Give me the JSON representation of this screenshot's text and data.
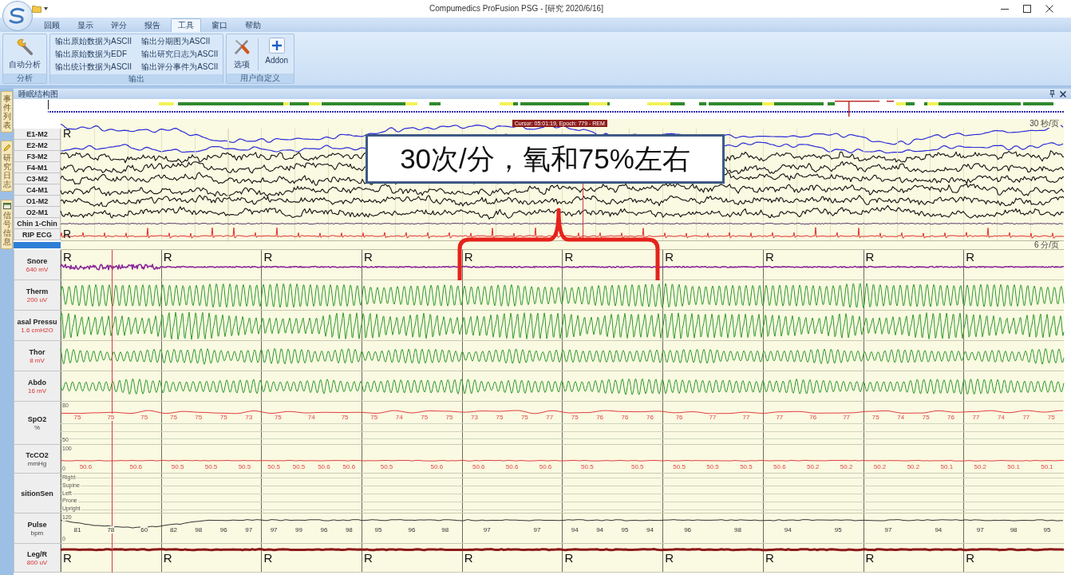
{
  "window": {
    "title": "Compumedics ProFusion PSG - [研究 2020/6/16]"
  },
  "ribbon": {
    "tabs": [
      {
        "label": "回顾",
        "selected": false
      },
      {
        "label": "显示",
        "selected": false
      },
      {
        "label": "评分",
        "selected": false
      },
      {
        "label": "报告",
        "selected": false
      },
      {
        "label": "工具",
        "selected": true
      },
      {
        "label": "窗口",
        "selected": false
      },
      {
        "label": "帮助",
        "selected": false
      }
    ],
    "groups": [
      {
        "label": "分析",
        "items": [
          {
            "kind": "large",
            "label": "自动分析"
          }
        ]
      },
      {
        "label": "输出",
        "items": [
          {
            "kind": "small",
            "label": "输出原始数据为ASCII"
          },
          {
            "kind": "small",
            "label": "输出原始数据为EDF"
          },
          {
            "kind": "small",
            "label": "输出统计数据为ASCII"
          },
          {
            "kind": "small",
            "label": "输出分期图为ASCII"
          },
          {
            "kind": "small",
            "label": "输出研究日志为ASCII"
          },
          {
            "kind": "small",
            "label": "输出评分事件为ASCII"
          }
        ]
      },
      {
        "label": "用户自定义",
        "items": [
          {
            "kind": "large",
            "label": "选项"
          },
          {
            "kind": "large",
            "label": "Addon"
          }
        ]
      }
    ]
  },
  "side_tabs": [
    {
      "label": "事件列表"
    },
    {
      "label": "研究日志"
    },
    {
      "label": "信号信息"
    }
  ],
  "hypnogram": {
    "title": "睡眠结构图"
  },
  "eeg_panel": {
    "cursor": "Cursor: 05:01:19, Epoch: 779 - REM",
    "timebase": "30 秒/页",
    "channels": [
      {
        "name": "E1-M2",
        "kind": "eog",
        "color": "#2b2bd9",
        "marks": [
          "R"
        ]
      },
      {
        "name": "E2-M2",
        "kind": "eog",
        "color": "#2b2bd9"
      },
      {
        "name": "F3-M2",
        "kind": "eeg",
        "color": "#111111"
      },
      {
        "name": "F4-M1",
        "kind": "eeg",
        "color": "#111111"
      },
      {
        "name": "C3-M2",
        "kind": "eeg",
        "color": "#111111"
      },
      {
        "name": "C4-M1",
        "kind": "eeg",
        "color": "#111111"
      },
      {
        "name": "O1-M2",
        "kind": "eeg",
        "color": "#111111"
      },
      {
        "name": "O2-M1",
        "kind": "eeg",
        "color": "#111111"
      },
      {
        "name": "Chin 1-Chin",
        "kind": "emg",
        "color": "#5a3a6a"
      },
      {
        "name": "RIP ECG",
        "kind": "ecg",
        "color": "#e0302a",
        "marks": [
          "R"
        ]
      }
    ]
  },
  "respiratory_panel": {
    "timebase": "6 分/页",
    "channels": [
      {
        "name": "Snore",
        "unit": "640 mV",
        "kind": "snore",
        "color": "#8a2a9a",
        "marks": [
          "R",
          "R",
          "R",
          "R",
          "R",
          "R",
          "R",
          "R",
          "R",
          "R"
        ]
      },
      {
        "name": "Therm",
        "unit": "200 uV",
        "kind": "flow",
        "color": "#2e9a2e"
      },
      {
        "name": "asal Pressu",
        "unit": "1.6 cmH2O",
        "kind": "pressure",
        "color": "#2e9a2e"
      },
      {
        "name": "Thor",
        "unit": "8 mV",
        "kind": "effort",
        "color": "#2e9a2e"
      },
      {
        "name": "Abdo",
        "unit": "16 mV",
        "kind": "effort",
        "color": "#2e9a2e"
      },
      {
        "name": "SpO2",
        "unit": "%",
        "kind": "spo2",
        "color": "#e04040",
        "scale": [
          "80",
          "50"
        ],
        "readings": [
          [
            "75",
            "75",
            "75"
          ],
          [
            "75",
            "75",
            "75",
            "73"
          ],
          [
            "75",
            "74",
            "75"
          ],
          [
            "75",
            "74",
            "75",
            "75"
          ],
          [
            "73",
            "75",
            "75",
            "77"
          ],
          [
            "75",
            "76",
            "76",
            "76"
          ],
          [
            "76",
            "77",
            "77"
          ],
          [
            "77",
            "76",
            "77"
          ],
          [
            "75",
            "74",
            "75",
            "76"
          ],
          [
            "77",
            "74",
            "77",
            "75"
          ]
        ]
      },
      {
        "name": "TcCO2",
        "unit": "mmHg",
        "kind": "tcco2",
        "color": "#e04040",
        "scale": [
          "100",
          "0"
        ],
        "readings": [
          [
            "50.6",
            "50.6"
          ],
          [
            "50.5",
            "50.5",
            "50.5"
          ],
          [
            "50.5",
            "50.5",
            "50.6",
            "50.6"
          ],
          [
            "50.5",
            "50.6"
          ],
          [
            "50.6",
            "50.6",
            "50.6"
          ],
          [
            "50.5",
            "50.5"
          ],
          [
            "50.5",
            "50.5",
            "50.5"
          ],
          [
            "50.6",
            "50.2",
            "50.2"
          ],
          [
            "50.2",
            "50.2",
            "50.1"
          ],
          [
            "50.2",
            "50.1",
            "50.1"
          ]
        ]
      },
      {
        "name": "sitionSen",
        "kind": "position",
        "scale": [
          "Right",
          "Supine",
          "Left",
          "Prone",
          "Upright"
        ]
      },
      {
        "name": "Pulse",
        "unit": "bpm",
        "kind": "pulse",
        "color": "#333333",
        "scale": [
          "120",
          "0"
        ],
        "readings": [
          [
            "81",
            "78",
            "60"
          ],
          [
            "82",
            "98",
            "96",
            "97"
          ],
          [
            "97",
            "99",
            "96",
            "98"
          ],
          [
            "95",
            "96",
            "98"
          ],
          [
            "97",
            "97"
          ],
          [
            "94",
            "94",
            "95",
            "94"
          ],
          [
            "96",
            "98"
          ],
          [
            "94",
            "95"
          ],
          [
            "97",
            "94"
          ],
          [
            "97",
            "98",
            "95"
          ]
        ]
      },
      {
        "name": "Leg/R",
        "unit": "800 uV",
        "kind": "leg",
        "color": "#8b1a1a",
        "marks": [
          "R",
          "R",
          "R",
          "R",
          "R",
          "R",
          "R",
          "R",
          "R",
          "R"
        ]
      }
    ]
  },
  "annotation": {
    "text": "30次/分，氧和75%左右"
  }
}
